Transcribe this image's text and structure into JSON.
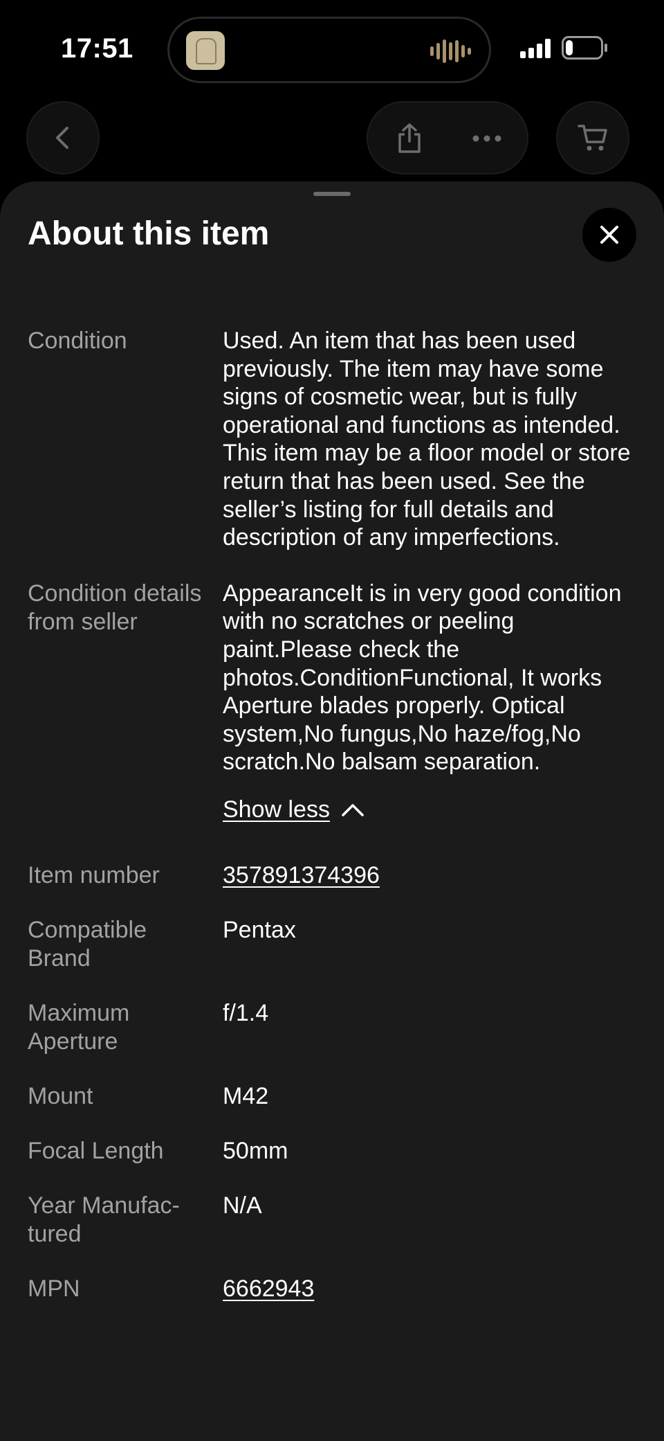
{
  "status_bar": {
    "time": "17:51",
    "battery": "21",
    "battery_level": 0.21
  },
  "nav": {
    "back_icon": "chevron-left-icon",
    "share_icon": "share-icon",
    "more_icon": "ellipsis-icon",
    "cart_icon": "cart-icon"
  },
  "sheet": {
    "title": "About this item",
    "close_icon": "close-icon",
    "show_less": "Show less",
    "specs": [
      {
        "label": "Condition",
        "value": "Used. An item that has been used previously. The item may have some signs of cosmetic wear, but is fully operational and functions as intended. This item may be a floor model or store return that has been used. See the seller’s listing for full details and description of any imperfections."
      },
      {
        "label": "Condition details from seller",
        "value": "AppearanceIt is in very good condition with no scratches or peeling paint.Please check the photos.ConditionFunctional, It works Aperture blades properly. Optical system,No fungus,No haze/fog,No scratch.No balsam separation."
      },
      {
        "label": "Item number",
        "value": "357891374396"
      },
      {
        "label": "Compatible Brand",
        "value": "Pentax"
      },
      {
        "label": "Maximum Aperture",
        "value": "f/1.4"
      },
      {
        "label": "Mount",
        "value": "M42"
      },
      {
        "label": "Focal Length",
        "value": "50mm"
      },
      {
        "label": "Year Manufac-tured",
        "value": "N/A"
      },
      {
        "label": "MPN",
        "value": "6662943"
      }
    ]
  },
  "colors": {
    "sheet_bg": "#1b1b1b",
    "label": "#a2a2a2",
    "text": "#ffffff",
    "background": "#000000"
  }
}
